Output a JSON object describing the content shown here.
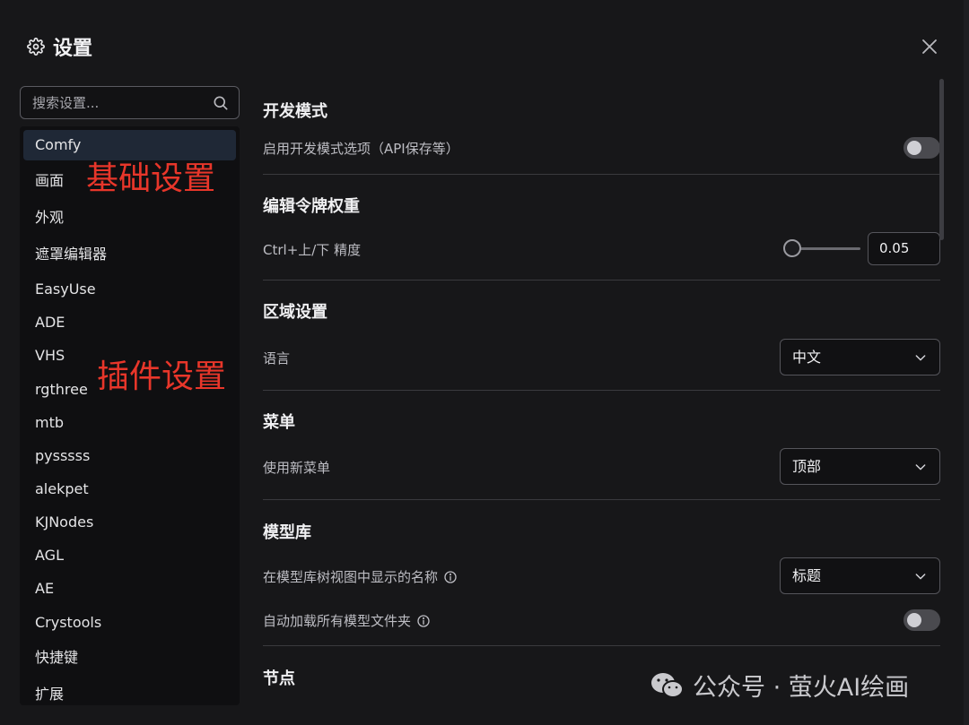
{
  "dialog": {
    "title": "设置",
    "title_icon": "gear-icon",
    "close_icon": "close-icon"
  },
  "search": {
    "placeholder": "搜索设置...",
    "value": ""
  },
  "sidebar": {
    "items": [
      {
        "label": "Comfy",
        "active": true
      },
      {
        "label": "画面"
      },
      {
        "label": "外观"
      },
      {
        "label": "遮罩编辑器"
      },
      {
        "label": "EasyUse"
      },
      {
        "label": "ADE"
      },
      {
        "label": "VHS"
      },
      {
        "label": "rgthree"
      },
      {
        "label": "mtb"
      },
      {
        "label": "pysssss"
      },
      {
        "label": "alekpet"
      },
      {
        "label": "KJNodes"
      },
      {
        "label": "AGL"
      },
      {
        "label": "AE"
      },
      {
        "label": "Crystools"
      },
      {
        "label": "快捷键"
      },
      {
        "label": "扩展"
      }
    ]
  },
  "annotations": {
    "basic": "基础设置",
    "plugins": "插件设置"
  },
  "sections": {
    "dev": {
      "title": "开发模式",
      "option_label": "启用开发模式选项（API保存等）",
      "enabled": false
    },
    "token": {
      "title": "编辑令牌权重",
      "option_label": "Ctrl+上/下 精度",
      "value": "0.05"
    },
    "locale": {
      "title": "区域设置",
      "option_label": "语言",
      "value": "中文"
    },
    "menu": {
      "title": "菜单",
      "option_label": "使用新菜单",
      "value": "顶部"
    },
    "model_library": {
      "title": "模型库",
      "name_label": "在模型库树视图中显示的名称",
      "name_value": "标题",
      "autoload_label": "自动加载所有模型文件夹",
      "autoload_enabled": false
    },
    "node": {
      "title": "节点"
    }
  },
  "watermark": {
    "text": "公众号 · 萤火AI绘画"
  },
  "colors": {
    "annotation": "#e8362a",
    "active_item": "#1f2836",
    "background": "#171719"
  }
}
